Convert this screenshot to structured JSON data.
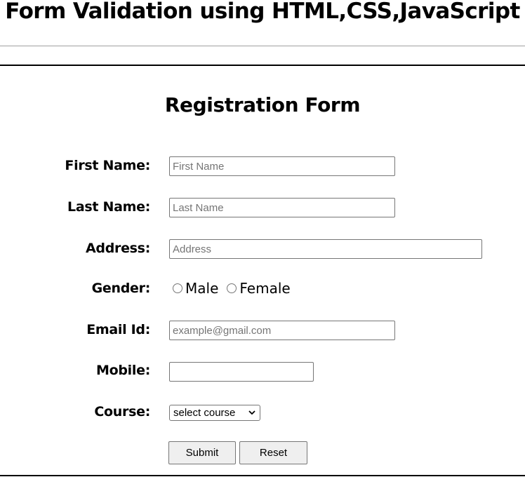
{
  "page": {
    "title": "Form Validation using HTML,CSS,JavaScript"
  },
  "form": {
    "title": "Registration Form",
    "fields": {
      "first_name": {
        "label": "First Name:",
        "placeholder": "First Name",
        "value": ""
      },
      "last_name": {
        "label": "Last Name:",
        "placeholder": "Last Name",
        "value": ""
      },
      "address": {
        "label": "Address:",
        "placeholder": "Address",
        "value": ""
      },
      "gender": {
        "label": "Gender:",
        "options": [
          "Male",
          "Female"
        ]
      },
      "email": {
        "label": "Email Id:",
        "placeholder": "example@gmail.com",
        "value": ""
      },
      "mobile": {
        "label": "Mobile:",
        "placeholder": "",
        "value": ""
      },
      "course": {
        "label": "Course:",
        "selected": "select course"
      }
    },
    "buttons": {
      "submit": "Submit",
      "reset": "Reset"
    }
  },
  "colors": {
    "rule_dark": "#000000",
    "rule_light": "#a0a0a0",
    "input_border": "#767676",
    "button_bg": "#efefef",
    "placeholder": "#757575"
  }
}
